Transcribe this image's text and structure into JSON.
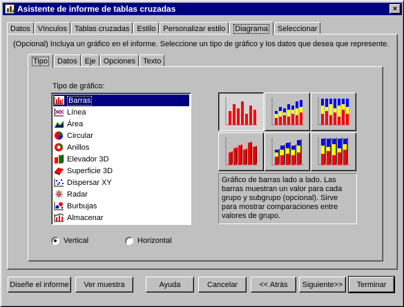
{
  "window": {
    "title": "Asistente de informe de tablas cruzadas",
    "close_glyph": "×"
  },
  "main_tabs": [
    {
      "label": "Datos"
    },
    {
      "label": "Vínculos"
    },
    {
      "label": "Tablas cruzadas"
    },
    {
      "label": "Estilo"
    },
    {
      "label": "Personalizar estilo"
    },
    {
      "label": "Diagrama",
      "active": true
    },
    {
      "label": "Seleccionar"
    }
  ],
  "intro_text": "(Opcional) Incluya un gráfico en el informe. Seleccione un tipo de gráfico y los datos que desea que represente.",
  "sub_tabs": [
    {
      "label": "Tipo",
      "active": true
    },
    {
      "label": "Datos"
    },
    {
      "label": "Eje"
    },
    {
      "label": "Opciones"
    },
    {
      "label": "Texto"
    }
  ],
  "chart_type_label": "Tipo de gráfico:",
  "chart_types": [
    {
      "label": "Barras",
      "icon": "bar-chart-icon",
      "selected": true
    },
    {
      "label": "Línea",
      "icon": "line-chart-icon"
    },
    {
      "label": "Área",
      "icon": "area-chart-icon"
    },
    {
      "label": "Circular",
      "icon": "pie-chart-icon"
    },
    {
      "label": "Anillos",
      "icon": "doughnut-chart-icon"
    },
    {
      "label": "Elevador 3D",
      "icon": "riser-3d-icon"
    },
    {
      "label": "Superficie 3D",
      "icon": "surface-3d-icon"
    },
    {
      "label": "Dispersar XY",
      "icon": "scatter-chart-icon"
    },
    {
      "label": "Radar",
      "icon": "radar-chart-icon"
    },
    {
      "label": "Burbujas",
      "icon": "bubble-chart-icon"
    },
    {
      "label": "Almacenar",
      "icon": "stock-chart-icon"
    }
  ],
  "subtypes": [
    {
      "name": "side-by-side-bars",
      "pressed": true
    },
    {
      "name": "stacked-bars"
    },
    {
      "name": "percent-bars"
    },
    {
      "name": "3d-side-by-side-bars"
    },
    {
      "name": "3d-stacked-bars"
    },
    {
      "name": "3d-percent-bars"
    }
  ],
  "description": "Gráfico de barras lado a lado. Las barras muestran un valor para cada grupo y subgrupo (opcional). Sirve para mostrar comparaciones entre valores de grupo.",
  "orientation": {
    "vertical_label": "Vertical",
    "horizontal_label": "Horizontal",
    "selected": "vertical"
  },
  "buttons": {
    "design": "Diseñe el informe",
    "preview": "Ver muestra",
    "help": "Ayuda",
    "cancel": "Cancelar",
    "back": "<< Atrás",
    "next": "Siguiente>>",
    "finish": "Terminar"
  },
  "colors": {
    "titlebar": "#000080",
    "selection": "#000080",
    "bar_red": "#ff0000",
    "bar_yellow": "#ffff00",
    "bar_blue": "#0000ff"
  }
}
